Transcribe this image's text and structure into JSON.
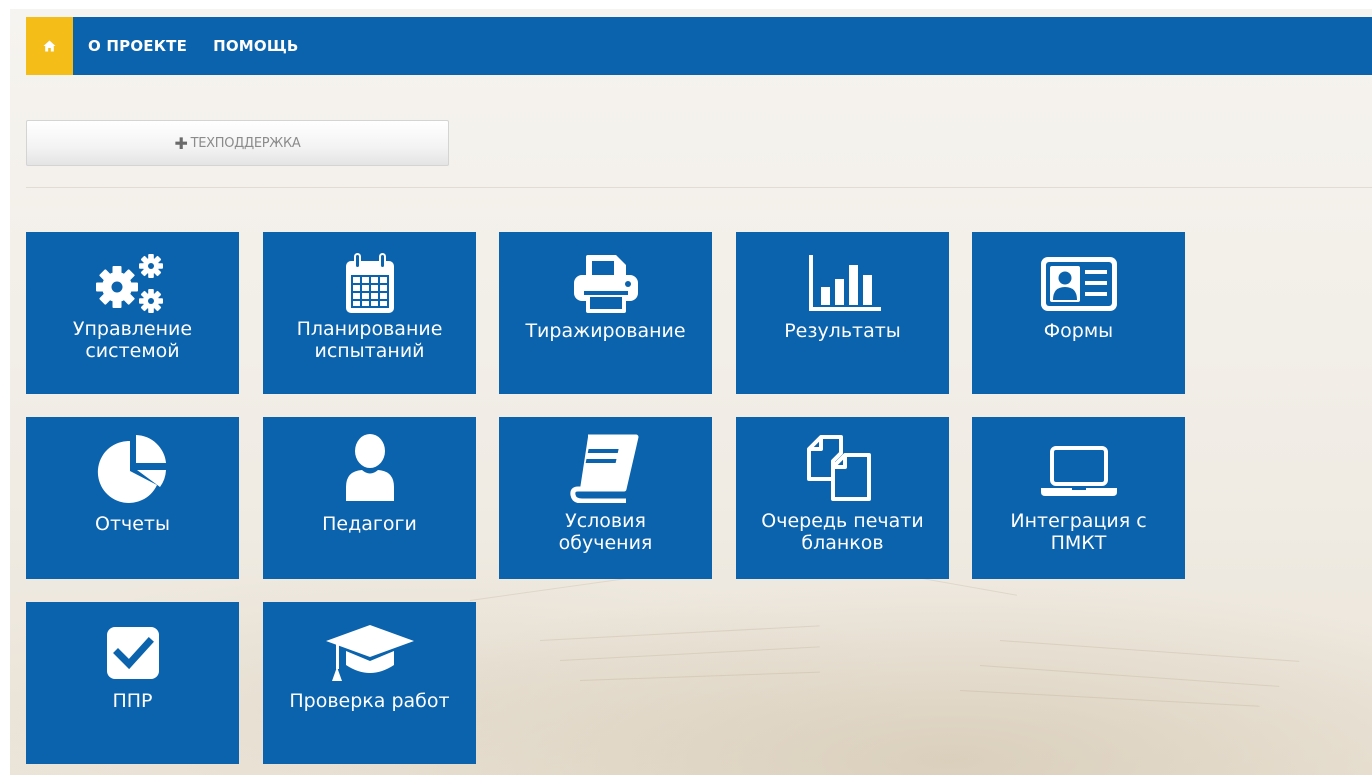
{
  "nav": {
    "home_icon": "home-icon",
    "links": [
      "О ПРОЕКТЕ",
      "ПОМОЩЬ"
    ]
  },
  "support": {
    "icon": "plus-icon",
    "label": "ТЕХПОДДЕРЖКА"
  },
  "tiles": [
    {
      "label": "Управление\nсистемой",
      "icon": "gears-icon"
    },
    {
      "label": "Планирование\nиспытаний",
      "icon": "calendar-icon"
    },
    {
      "label": "Тиражирование",
      "icon": "printer-icon"
    },
    {
      "label": "Результаты",
      "icon": "bar-chart-icon"
    },
    {
      "label": "Формы",
      "icon": "id-card-icon"
    },
    {
      "label": "Отчеты",
      "icon": "pie-chart-icon"
    },
    {
      "label": "Педагоги",
      "icon": "user-icon"
    },
    {
      "label": "Условия\nобучения",
      "icon": "book-icon"
    },
    {
      "label": "Очередь печати\nбланков",
      "icon": "copy-icon"
    },
    {
      "label": "Интеграция с\nПМКТ",
      "icon": "laptop-icon"
    },
    {
      "label": "ППР",
      "icon": "checkbox-icon"
    },
    {
      "label": "Проверка работ",
      "icon": "graduation-cap-icon"
    }
  ],
  "colors": {
    "primary": "#0a63ac",
    "accent": "#f4bd17",
    "background": "#f2efea"
  }
}
